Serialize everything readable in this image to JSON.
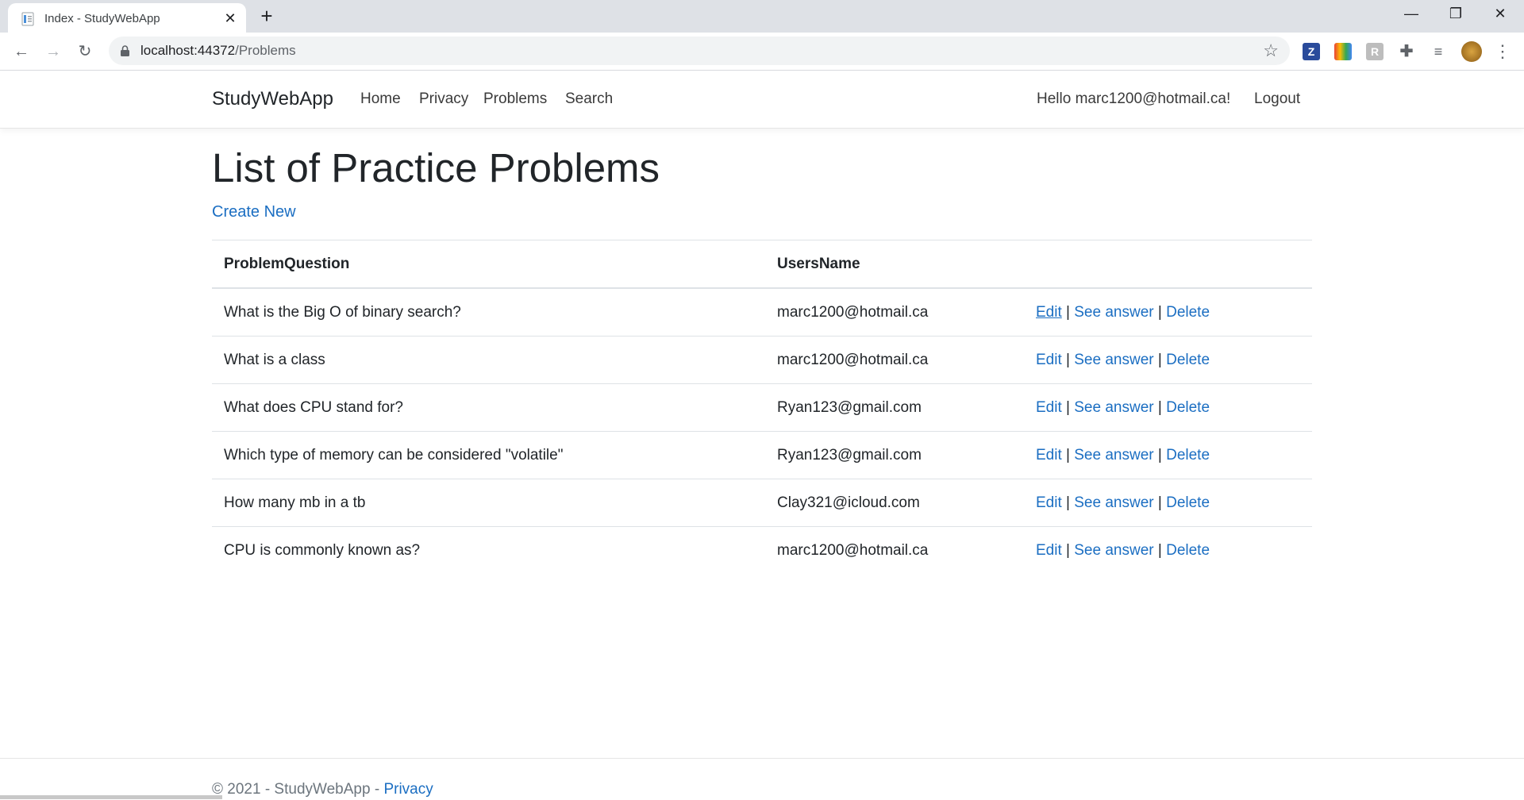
{
  "browser": {
    "tab_title": "Index - StudyWebApp",
    "url_host": "localhost:44372",
    "url_path": "/Problems",
    "extensions": [
      "zotero-icon",
      "color-extension-icon",
      "readability-extension-icon",
      "puzzle-icon",
      "reading-list-icon",
      "profile-avatar"
    ]
  },
  "site": {
    "brand": "StudyWebApp",
    "nav": [
      "Home",
      "Privacy",
      "Problems",
      "Search"
    ],
    "greeting": "Hello marc1200@hotmail.ca!",
    "logout": "Logout"
  },
  "main": {
    "title": "List of Practice Problems",
    "create_new": "Create New",
    "columns": [
      "ProblemQuestion",
      "UsersName"
    ],
    "rows": [
      {
        "question": "What is the Big O of binary search?",
        "user": "marc1200@hotmail.ca"
      },
      {
        "question": "What is a class",
        "user": "marc1200@hotmail.ca"
      },
      {
        "question": "What does CPU stand for?",
        "user": "Ryan123@gmail.com"
      },
      {
        "question": "Which type of memory can be considered \"volatile\"",
        "user": "Ryan123@gmail.com"
      },
      {
        "question": "How many mb in a tb",
        "user": "Clay321@icloud.com"
      },
      {
        "question": "CPU is commonly known as?",
        "user": "marc1200@hotmail.ca"
      }
    ],
    "actions": {
      "edit": "Edit",
      "see_answer": "See answer",
      "delete": "Delete",
      "separator": "|"
    }
  },
  "footer": {
    "text": "© 2021 - StudyWebApp - ",
    "link": "Privacy"
  },
  "colors": {
    "link": "#1b6ec2",
    "text": "#212529",
    "muted": "#6c757d",
    "tabstrip": "#dee1e6"
  }
}
